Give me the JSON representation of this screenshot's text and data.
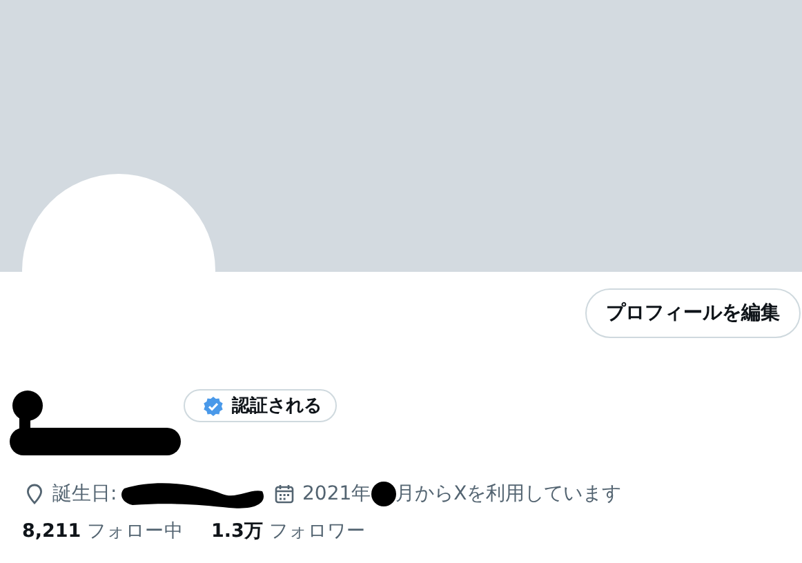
{
  "profile": {
    "edit_button": "プロフィールを編集",
    "verified_badge": "認証される",
    "birthday": "誕生日: ",
    "joined": [
      "2021年",
      "月からXを利用しています"
    ],
    "stats": [
      {
        "count": "8,211",
        "label": "フォロー中"
      },
      {
        "count": "1.3万",
        "label": "フォロワー"
      }
    ]
  }
}
